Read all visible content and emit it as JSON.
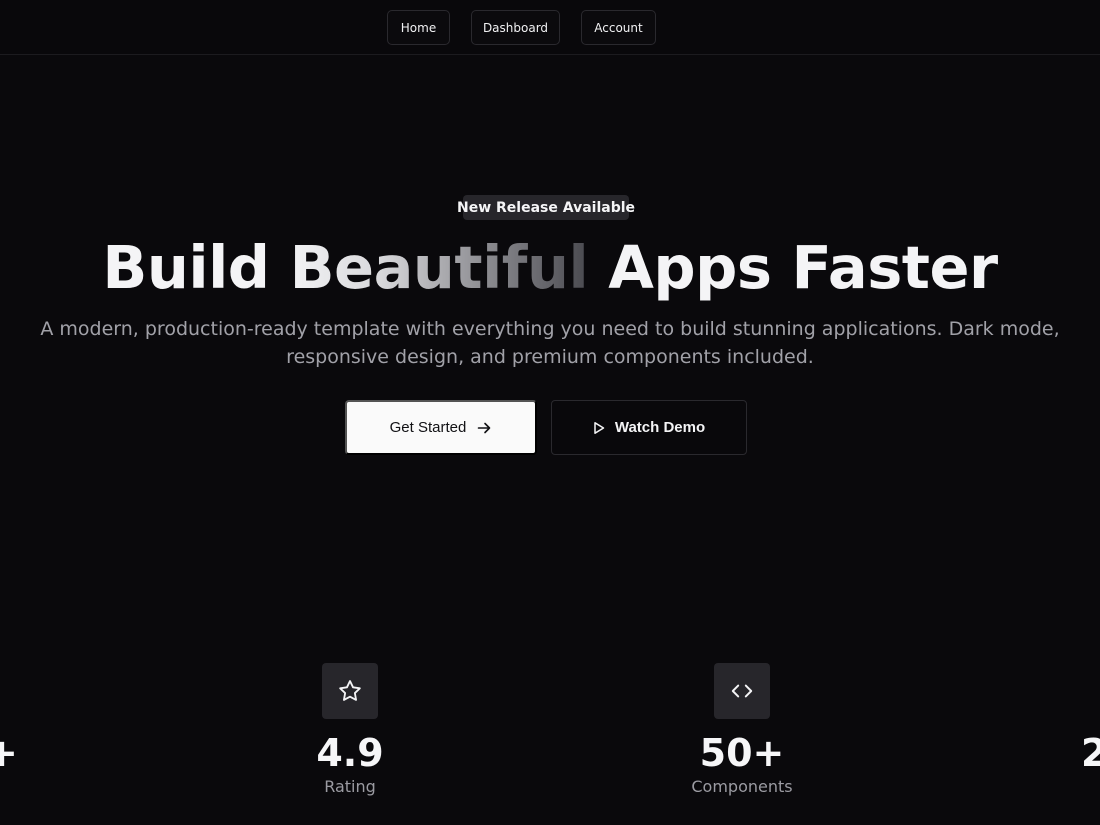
{
  "nav": {
    "items": [
      {
        "label": "Home"
      },
      {
        "label": "Dashboard"
      },
      {
        "label": "Account"
      }
    ]
  },
  "hero": {
    "badge": "New Release Available",
    "headline": {
      "part1": "Build ",
      "highlight": "Beautiful",
      "part2": " Apps Faster"
    },
    "subtitle_line1": "A modern, production-ready template with everything you need to build stunning applications. Dark mode,",
    "subtitle_line2": "responsive design, and premium components included.",
    "primary_cta": "Get Started",
    "secondary_cta": "Watch Demo"
  },
  "stats": [
    {
      "icon": "star-icon",
      "value": "4.9",
      "label": "Rating"
    },
    {
      "icon": "code-icon",
      "value": "50+",
      "label": "Components"
    }
  ],
  "edge_stats": {
    "left_partial": "+",
    "right_partial": "2"
  },
  "colors": {
    "background": "#0a090c",
    "primary_button": "#fafafa",
    "icon_tile": "#27262b",
    "muted_text": "#a1a1a8"
  }
}
